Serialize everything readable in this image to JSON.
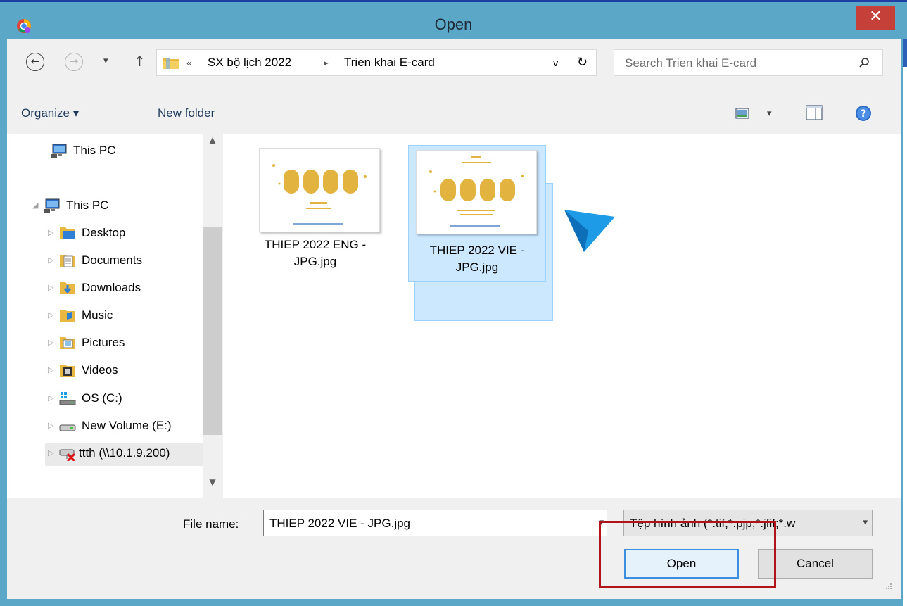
{
  "window": {
    "title": "Open",
    "close_glyph": "✕"
  },
  "nav": {
    "back_glyph": "←",
    "forward_glyph": "→",
    "recent_glyph": "▾",
    "up_glyph": "↑"
  },
  "address": {
    "overflow": "«",
    "crumbs": [
      "SX bộ lịch 2022",
      "Trien khai E-card"
    ],
    "separator": "▸",
    "dropdown_glyph": "v",
    "refresh_glyph": "↻"
  },
  "search": {
    "placeholder": "Search Trien khai E-card",
    "icon": "search-icon"
  },
  "toolbar": {
    "organize_label": "Organize ▾",
    "new_folder_label": "New folder",
    "view_dropdown_glyph": "▾"
  },
  "navpane": {
    "items": [
      {
        "label": "This PC",
        "icon": "computer-icon"
      },
      {
        "label": "This PC",
        "icon": "computer-icon"
      },
      {
        "label": "Desktop",
        "icon": "desktop-folder-icon"
      },
      {
        "label": "Documents",
        "icon": "documents-folder-icon"
      },
      {
        "label": "Downloads",
        "icon": "downloads-folder-icon"
      },
      {
        "label": "Music",
        "icon": "music-folder-icon"
      },
      {
        "label": "Pictures",
        "icon": "pictures-folder-icon"
      },
      {
        "label": "Videos",
        "icon": "videos-folder-icon"
      },
      {
        "label": "OS (C:)",
        "icon": "drive-c-icon"
      },
      {
        "label": "New Volume (E:)",
        "icon": "drive-icon"
      },
      {
        "label": "ttth (\\\\10.1.9.200)",
        "icon": "disconnected-network-drive-icon"
      }
    ],
    "scroll_up": "▲",
    "scroll_down": "▼"
  },
  "files": [
    {
      "name_line1": "THIEP 2022 ENG -",
      "name_line2": "JPG.jpg",
      "selected": false
    },
    {
      "name_line1": "THIEP 2022 VIE -",
      "name_line2": "JPG.jpg",
      "selected": true
    }
  ],
  "bottom": {
    "file_name_label": "File name:",
    "file_name_value": "THIEP 2022 VIE - JPG.jpg",
    "file_type_value": "Tệp hình ảnh (*.tif;*.pjp;*.jfif;*.w",
    "open_label": "Open",
    "cancel_label": "Cancel",
    "dropdown_glyph": "▾"
  },
  "colors": {
    "frame": "#5ba7c7",
    "close": "#c6403a",
    "selection": "#cce8ff",
    "highlight": "#b3121a",
    "cursor": "#1e9be6"
  }
}
